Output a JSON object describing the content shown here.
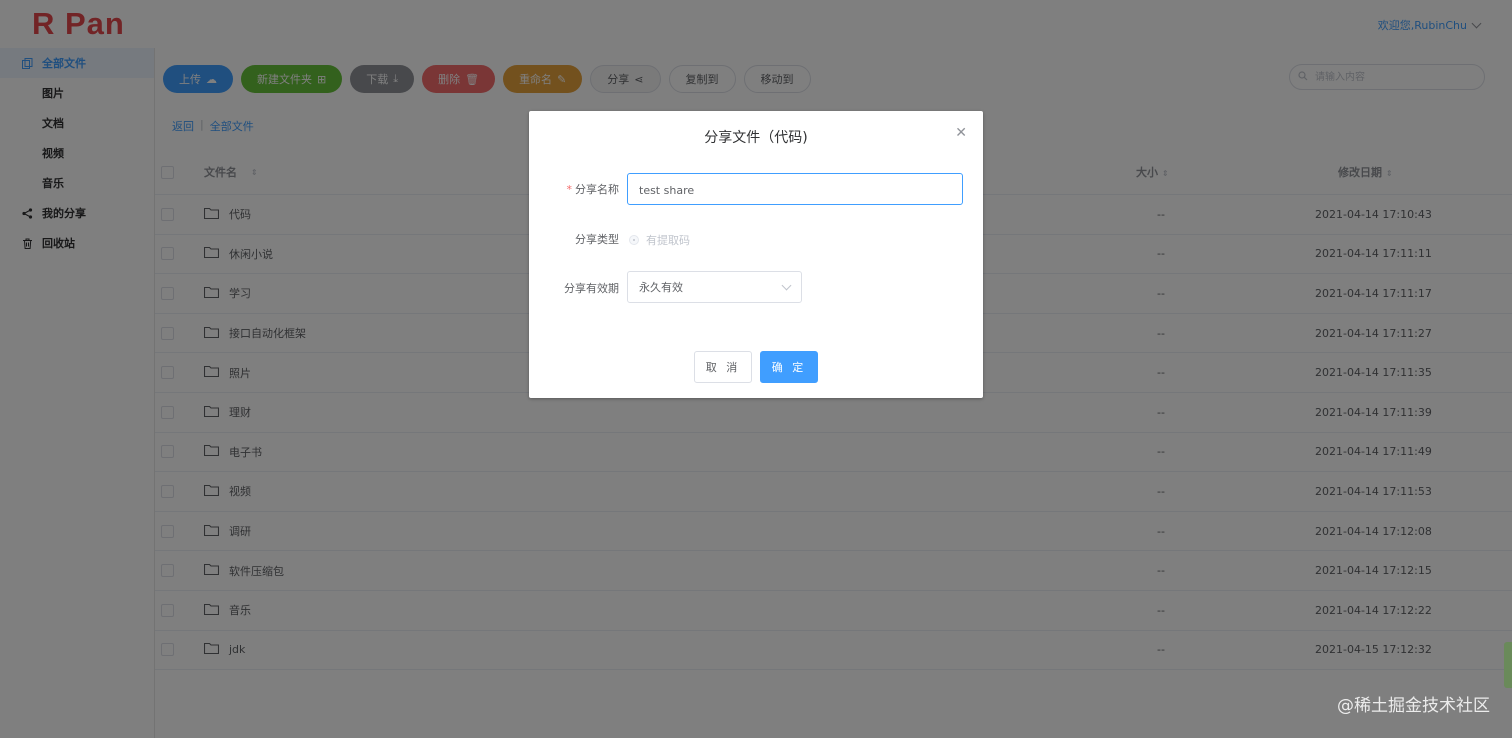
{
  "app": {
    "logo": "R Pan",
    "user_greeting": "欢迎您,RubinChu"
  },
  "sidebar": {
    "items": [
      {
        "label": "全部文件",
        "icon": "files-icon",
        "active": true
      },
      {
        "label": "图片"
      },
      {
        "label": "文档"
      },
      {
        "label": "视频"
      },
      {
        "label": "音乐"
      },
      {
        "label": "我的分享",
        "icon": "share-icon"
      },
      {
        "label": "回收站",
        "icon": "trash-icon"
      }
    ]
  },
  "toolbar": {
    "upload": "上传",
    "new_folder": "新建文件夹",
    "download": "下载",
    "delete": "删除",
    "rename": "重命名",
    "share": "分享",
    "copy_to": "复制到",
    "move_to": "移动到"
  },
  "search": {
    "placeholder": "请输入内容"
  },
  "breadcrumb": {
    "back": "返回",
    "sep": "|",
    "current": "全部文件"
  },
  "table": {
    "headers": {
      "name": "文件名",
      "size": "大小",
      "date": "修改日期"
    },
    "rows": [
      {
        "name": "代码",
        "size": "--",
        "date": "2021-04-14 17:10:43"
      },
      {
        "name": "休闲小说",
        "size": "--",
        "date": "2021-04-14 17:11:11"
      },
      {
        "name": "学习",
        "size": "--",
        "date": "2021-04-14 17:11:17"
      },
      {
        "name": "接口自动化框架",
        "size": "--",
        "date": "2021-04-14 17:11:27"
      },
      {
        "name": "照片",
        "size": "--",
        "date": "2021-04-14 17:11:35"
      },
      {
        "name": "理财",
        "size": "--",
        "date": "2021-04-14 17:11:39"
      },
      {
        "name": "电子书",
        "size": "--",
        "date": "2021-04-14 17:11:49"
      },
      {
        "name": "视频",
        "size": "--",
        "date": "2021-04-14 17:11:53"
      },
      {
        "name": "调研",
        "size": "--",
        "date": "2021-04-14 17:12:08"
      },
      {
        "name": "软件压缩包",
        "size": "--",
        "date": "2021-04-14 17:12:15"
      },
      {
        "name": "音乐",
        "size": "--",
        "date": "2021-04-14 17:12:22"
      },
      {
        "name": "jdk",
        "size": "--",
        "date": "2021-04-15 17:12:32"
      }
    ]
  },
  "dialog": {
    "title": "分享文件（代码)",
    "name_label": "分享名称",
    "required_mark": "*",
    "name_value": "test share",
    "type_label": "分享类型",
    "type_option": "有提取码",
    "expiry_label": "分享有效期",
    "expiry_value": "永久有效",
    "cancel": "取 消",
    "confirm": "确 定"
  },
  "watermark": "@稀土掘金技术社区"
}
